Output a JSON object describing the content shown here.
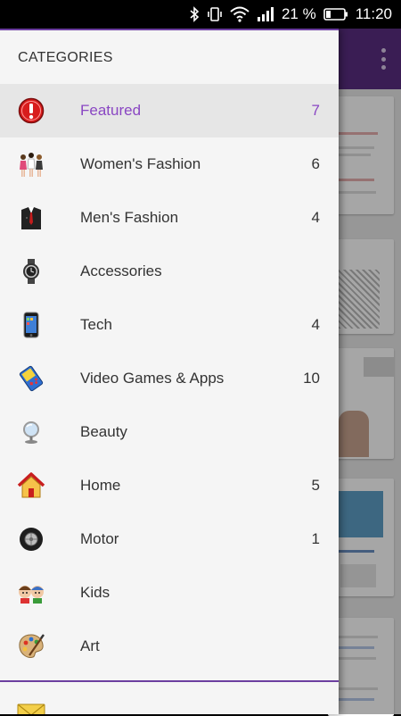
{
  "status_bar": {
    "battery": "21 %",
    "time": "11:20"
  },
  "drawer": {
    "title": "CATEGORIES",
    "categories": [
      {
        "label": "Featured",
        "count": "7",
        "icon": "alert-icon"
      },
      {
        "label": "Women's Fashion",
        "count": "6",
        "icon": "womens-fashion-icon"
      },
      {
        "label": "Men's Fashion",
        "count": "4",
        "icon": "mens-fashion-icon"
      },
      {
        "label": "Accessories",
        "count": "",
        "icon": "watch-icon"
      },
      {
        "label": "Tech",
        "count": "4",
        "icon": "phone-icon"
      },
      {
        "label": "Video Games & Apps",
        "count": "10",
        "icon": "gameboy-icon"
      },
      {
        "label": "Beauty",
        "count": "",
        "icon": "mirror-icon"
      },
      {
        "label": "Home",
        "count": "5",
        "icon": "house-icon"
      },
      {
        "label": "Motor",
        "count": "1",
        "icon": "tire-icon"
      },
      {
        "label": "Kids",
        "count": "",
        "icon": "kids-icon"
      },
      {
        "label": "Art",
        "count": "",
        "icon": "palette-icon"
      }
    ],
    "bottom_icon": "mail-icon"
  },
  "colors": {
    "accent": "#8a47c3",
    "appbar": "#5a2d82",
    "selected_row": "#e6e6e6"
  }
}
